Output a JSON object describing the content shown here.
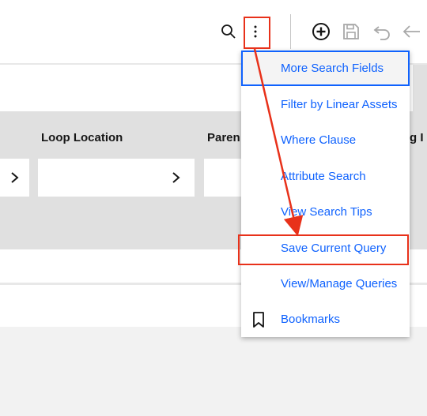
{
  "toolbar": {
    "icons": [
      "search-icon",
      "overflow-menu-icon",
      "add-icon",
      "save-icon",
      "undo-icon",
      "back-arrow-icon"
    ]
  },
  "table": {
    "columns": [
      "Loop Location",
      "Paren",
      "g I"
    ]
  },
  "menu": {
    "items": [
      {
        "label": "More Search Fields",
        "focused": true
      },
      {
        "label": "Filter by Linear Assets"
      },
      {
        "label": "Where Clause"
      },
      {
        "label": "Attribute Search"
      },
      {
        "label": "View Search Tips"
      },
      {
        "label": "Save Current Query",
        "highlighted": true
      },
      {
        "label": "View/Manage Queries"
      },
      {
        "label": "Bookmarks",
        "icon": "bookmark-icon"
      }
    ]
  },
  "colors": {
    "link": "#0f62fe",
    "annotation": "#e8311a",
    "header": "#e0e0e0"
  }
}
